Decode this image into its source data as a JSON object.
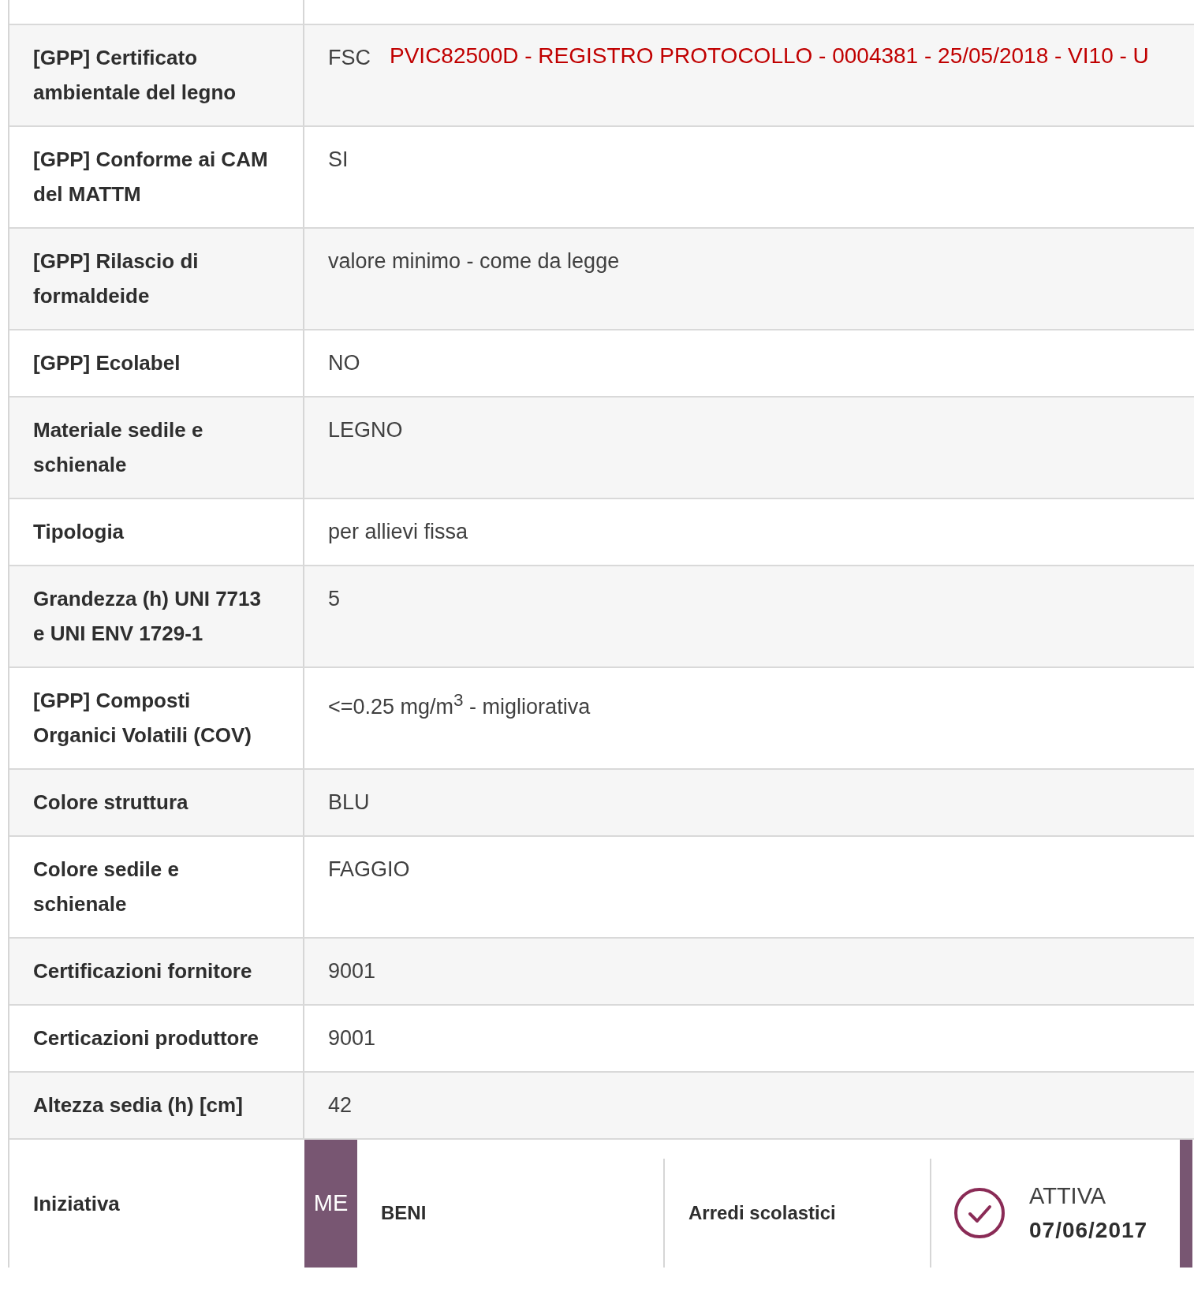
{
  "stamp": "PVIC82500D - REGISTRO PROTOCOLLO - 0004381 - 25/05/2018 - VI10 - U",
  "rows": [
    {
      "label": "[GPP] Certificato ambientale del legno",
      "value": "FSC"
    },
    {
      "label": "[GPP] Conforme ai CAM del MATTM",
      "value": "SI"
    },
    {
      "label": "[GPP] Rilascio di formaldeide",
      "value": "valore minimo - come da legge"
    },
    {
      "label": "[GPP] Ecolabel",
      "value": "NO"
    },
    {
      "label": "Materiale sedile e schienale",
      "value": "LEGNO"
    },
    {
      "label": "Tipologia",
      "value": "per allievi fissa"
    },
    {
      "label": "Grandezza (h) UNI 7713 e UNI ENV 1729-1",
      "value": "5"
    },
    {
      "label": "[GPP] Composti Organici Volatili (COV)",
      "value": "<=0.25 mg/m$^{3}$ - migliorativa"
    },
    {
      "label": "Colore struttura",
      "value": "BLU"
    },
    {
      "label": "Colore sedile e schienale",
      "value": "FAGGIO"
    },
    {
      "label": "Certificazioni fornitore",
      "value": "9001"
    },
    {
      "label": "Certicazioni produttore",
      "value": "9001"
    },
    {
      "label": "Altezza sedia (h) [cm]",
      "value": "42"
    }
  ],
  "initiative": {
    "label": "Iniziativa",
    "code": "ME",
    "type": "BENI",
    "category": "Arredi scolastici",
    "status": "ATTIVA",
    "date": "07/06/2017"
  }
}
